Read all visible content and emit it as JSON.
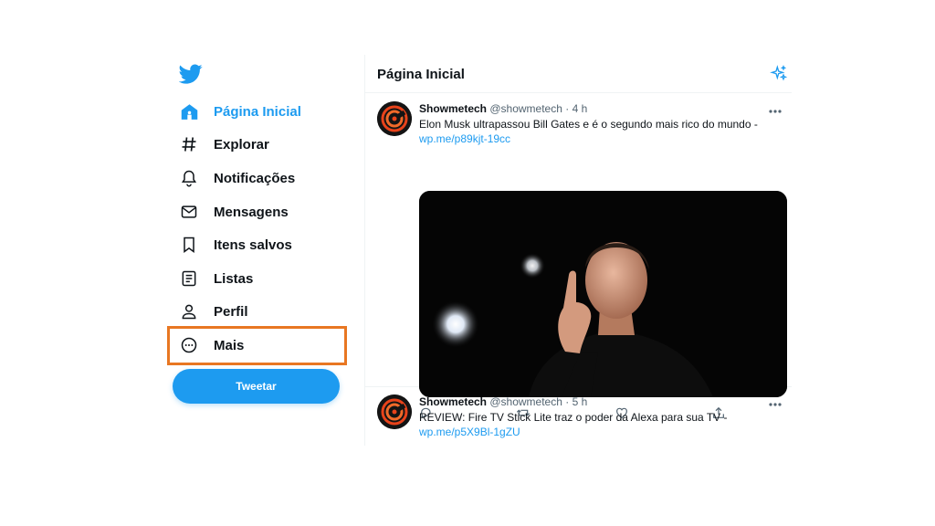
{
  "nav": {
    "items": [
      {
        "label": "Página Inicial",
        "icon": "home-icon"
      },
      {
        "label": "Explorar",
        "icon": "hashtag-icon"
      },
      {
        "label": "Notificações",
        "icon": "bell-icon"
      },
      {
        "label": "Mensagens",
        "icon": "envelope-icon"
      },
      {
        "label": "Itens salvos",
        "icon": "bookmark-icon"
      },
      {
        "label": "Listas",
        "icon": "list-icon"
      },
      {
        "label": "Perfil",
        "icon": "user-icon"
      },
      {
        "label": "Mais",
        "icon": "more-circle-icon"
      }
    ],
    "tweet_button": "Tweetar"
  },
  "main": {
    "title": "Página Inicial"
  },
  "tweets": [
    {
      "name": "Showmetech",
      "handle": "@showmetech",
      "time": "· 4 h",
      "text": "Elon Musk ultrapassou Bill Gates e é o segundo mais rico do mundo -",
      "link": "wp.me/p89kjt-19cc"
    },
    {
      "name": "Showmetech",
      "handle": "@showmetech",
      "time": "· 5 h",
      "text": "REVIEW: Fire TV Stick Lite traz o poder da Alexa para sua TV -",
      "link": "wp.me/p5X9Bl-1gZU"
    }
  ],
  "colors": {
    "accent": "#1d9bf0",
    "highlight": "#e87722"
  }
}
